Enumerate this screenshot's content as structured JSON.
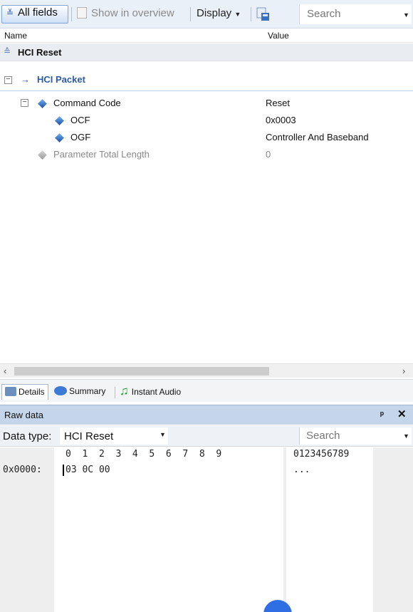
{
  "toolbar": {
    "all_fields": "All fields",
    "show_in_overview": "Show in overview",
    "display": "Display",
    "search_placeholder": "Search"
  },
  "columns": {
    "name": "Name",
    "value": "Value"
  },
  "summary_row": {
    "title": "HCI Reset"
  },
  "packet": {
    "label": "HCI Packet"
  },
  "fields": [
    {
      "name": "Command Code",
      "value": "Reset"
    },
    {
      "name": "OCF",
      "value": "0x0003"
    },
    {
      "name": "OGF",
      "value": "Controller And Baseband"
    },
    {
      "name": "Parameter Total Length",
      "value": "0"
    }
  ],
  "tabs": {
    "details": "Details",
    "summary": "Summary",
    "instant_audio": "Instant Audio"
  },
  "raw": {
    "title": "Raw data",
    "data_type_label": "Data type:",
    "data_type_value": "HCI Reset",
    "search_placeholder": "Search",
    "hex_header": "0  1  2  3  4  5  6  7  8  9",
    "ascii_header": "0123456789",
    "offset": "0x0000:",
    "hex_bytes": "03 0C 00",
    "ascii": "..."
  }
}
